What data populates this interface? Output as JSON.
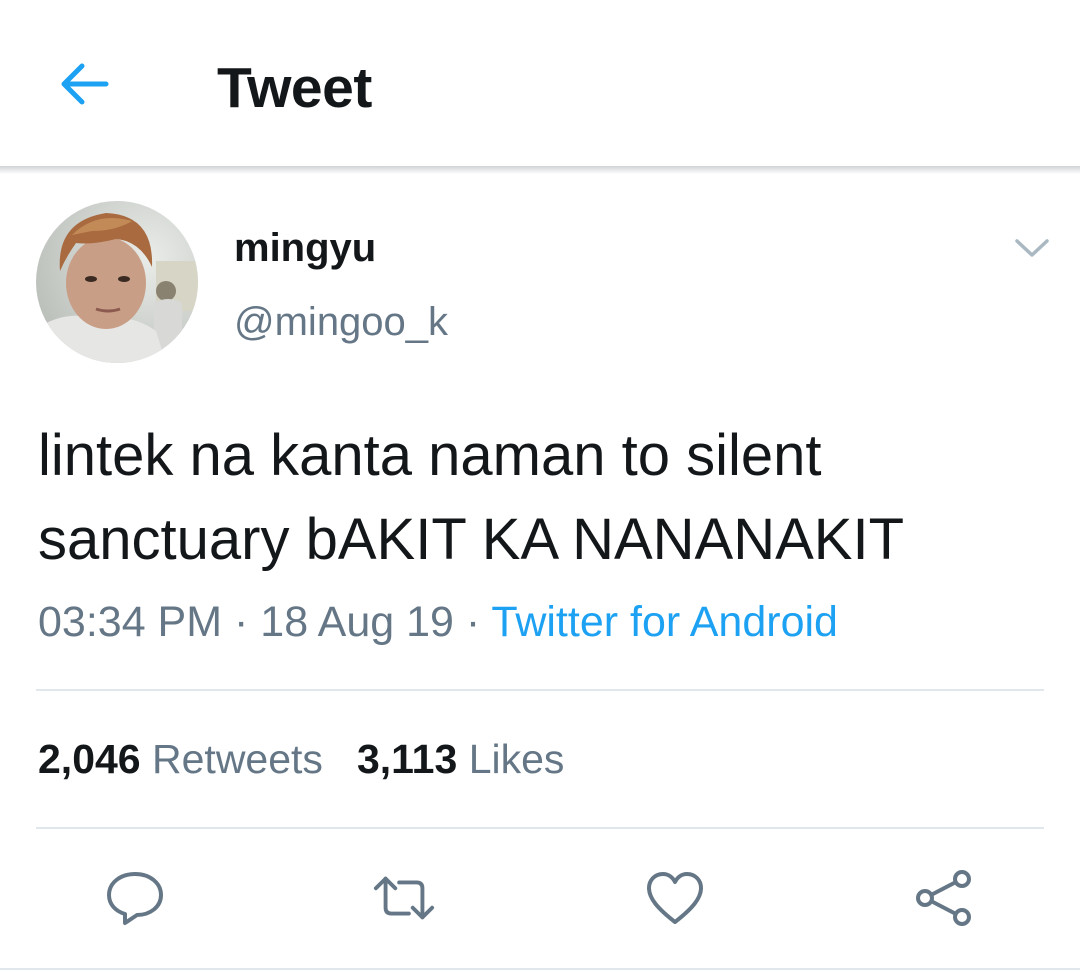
{
  "header": {
    "title": "Tweet",
    "back_icon": "arrow-left-icon"
  },
  "tweet": {
    "author": {
      "display_name": "mingyu",
      "handle": "@mingoo_k",
      "avatar": "user-avatar-photo"
    },
    "text_lines": [
      "lintek na kanta naman to silent",
      "sanctuary bAKIT KA NANANAKIT"
    ],
    "time": "03:34 PM",
    "separator": " · ",
    "date": "18 Aug 19",
    "source": "Twitter for Android",
    "stats": {
      "retweets_count": "2,046",
      "retweets_label": "Retweets",
      "likes_count": "3,113",
      "likes_label": "Likes"
    }
  },
  "actions": [
    {
      "name": "reply",
      "icon": "reply-icon"
    },
    {
      "name": "retweet",
      "icon": "retweet-icon"
    },
    {
      "name": "like",
      "icon": "heart-icon"
    },
    {
      "name": "share",
      "icon": "share-icon"
    }
  ],
  "colors": {
    "accent": "#1da1f2",
    "text": "#14171a",
    "secondary": "#657786",
    "divider": "#e1e8ed"
  }
}
